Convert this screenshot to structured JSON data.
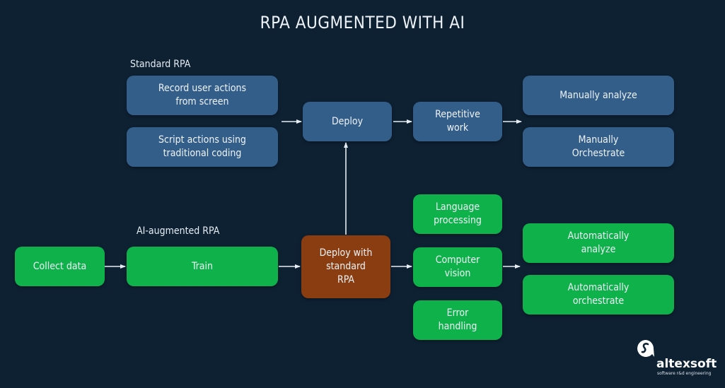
{
  "title": "RPA AUGMENTED WITH AI",
  "colors": {
    "background": "#0e2133",
    "standard_box": "#345e8a",
    "ai_box": "#0fb14b",
    "deploy_ai_box": "#8a3d10",
    "arrow": "#e6edf2"
  },
  "standard_rpa": {
    "label": "Standard RPA",
    "record": "Record user actions\nfrom screen",
    "script": "Script actions using\ntraditional coding",
    "deploy": "Deploy",
    "repetitive": "Repetitive\nwork",
    "manual_analyze": "Manually analyze",
    "manual_orchestrate": "Manually\nOrchestrate"
  },
  "ai_rpa": {
    "label": "AI-augmented RPA",
    "collect": "Collect data",
    "train": "Train",
    "deploy_standard": "Deploy with\nstandard\nRPA",
    "language": "Language\nprocessing",
    "vision": "Computer\nvision",
    "error": "Error\nhandling",
    "auto_analyze": "Automatically\nanalyze",
    "auto_orchestrate": "Automatically\norchestrate"
  },
  "logo": {
    "icon": "altexsoft-logo-icon",
    "name": "altexsoft",
    "tagline": "software r&d engineering"
  }
}
